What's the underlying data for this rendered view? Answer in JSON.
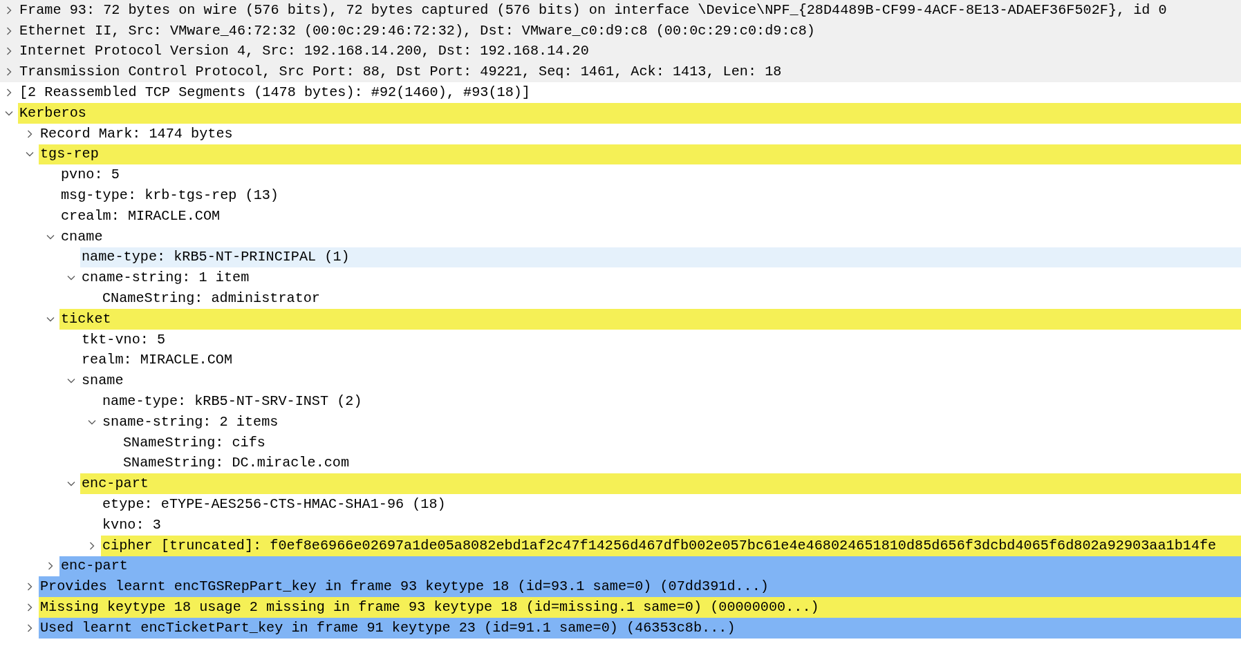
{
  "tree": [
    {
      "text": "Frame 93: 72 bytes on wire (576 bits), 72 bytes captured (576 bits) on interface \\Device\\NPF_{28D4489B-CF99-4ACF-8E13-ADAEF36F502F}, id 0",
      "expanded": false,
      "color": "#f0f0f0",
      "full_row": true
    },
    {
      "text": "Ethernet II, Src: VMware_46:72:32 (00:0c:29:46:72:32), Dst: VMware_c0:d9:c8 (00:0c:29:c0:d9:c8)",
      "expanded": false,
      "color": "#f0f0f0",
      "full_row": true
    },
    {
      "text": "Internet Protocol Version 4, Src: 192.168.14.200, Dst: 192.168.14.20",
      "expanded": false,
      "color": "#f0f0f0",
      "full_row": true
    },
    {
      "text": "Transmission Control Protocol, Src Port: 88, Dst Port: 49221, Seq: 1461, Ack: 1413, Len: 18",
      "expanded": false,
      "color": "#f0f0f0",
      "full_row": true
    },
    {
      "text": "[2 Reassembled TCP Segments (1478 bytes): #92(1460), #93(18)]",
      "expanded": false
    },
    {
      "text": "Kerberos",
      "expanded": true,
      "color": "#f5f056",
      "children": [
        {
          "text": "Record Mark: 1474 bytes",
          "expanded": false
        },
        {
          "text": "tgs-rep",
          "expanded": true,
          "color": "#f5f056",
          "children": [
            {
              "text": "pvno: 5"
            },
            {
              "text": "msg-type: krb-tgs-rep (13)"
            },
            {
              "text": "crealm: MIRACLE.COM"
            },
            {
              "text": "cname",
              "expanded": true,
              "children": [
                {
                  "text": "name-type: kRB5-NT-PRINCIPAL (1)",
                  "color": "#e5f1fb"
                },
                {
                  "text": "cname-string: 1 item",
                  "expanded": true,
                  "children": [
                    {
                      "text": "CNameString: administrator"
                    }
                  ]
                }
              ]
            },
            {
              "text": "ticket",
              "expanded": true,
              "color": "#f5f056",
              "children": [
                {
                  "text": "tkt-vno: 5"
                },
                {
                  "text": "realm: MIRACLE.COM"
                },
                {
                  "text": "sname",
                  "expanded": true,
                  "children": [
                    {
                      "text": "name-type: kRB5-NT-SRV-INST (2)"
                    },
                    {
                      "text": "sname-string: 2 items",
                      "expanded": true,
                      "children": [
                        {
                          "text": "SNameString: cifs"
                        },
                        {
                          "text": "SNameString: DC.miracle.com"
                        }
                      ]
                    }
                  ]
                },
                {
                  "text": "enc-part",
                  "expanded": true,
                  "color": "#f5f056",
                  "children": [
                    {
                      "text": "etype: eTYPE-AES256-CTS-HMAC-SHA1-96 (18)"
                    },
                    {
                      "text": "kvno: 3"
                    },
                    {
                      "text": "cipher [truncated]: f0ef8e6966e02697a1de05a8082ebd1af2c47f14256d467dfb002e057bc61e4e468024651810d85d656f3dcbd4065f6d802a92903aa1b14fe",
                      "expanded": false,
                      "color": "#f5f056"
                    }
                  ]
                }
              ]
            },
            {
              "text": "enc-part",
              "expanded": false,
              "color": "#80b4f5"
            }
          ]
        },
        {
          "text": "Provides learnt encTGSRepPart_key in frame 93 keytype 18 (id=93.1 same=0) (07dd391d...)",
          "expanded": false,
          "color": "#80b4f5"
        },
        {
          "text": "Missing keytype 18 usage 2 missing in frame 93 keytype 18 (id=missing.1 same=0) (00000000...)",
          "expanded": false,
          "color": "#f5f056"
        },
        {
          "text": "Used learnt encTicketPart_key in frame 91 keytype 23 (id=91.1 same=0) (46353c8b...)",
          "expanded": false,
          "color": "#80b4f5"
        }
      ]
    }
  ]
}
